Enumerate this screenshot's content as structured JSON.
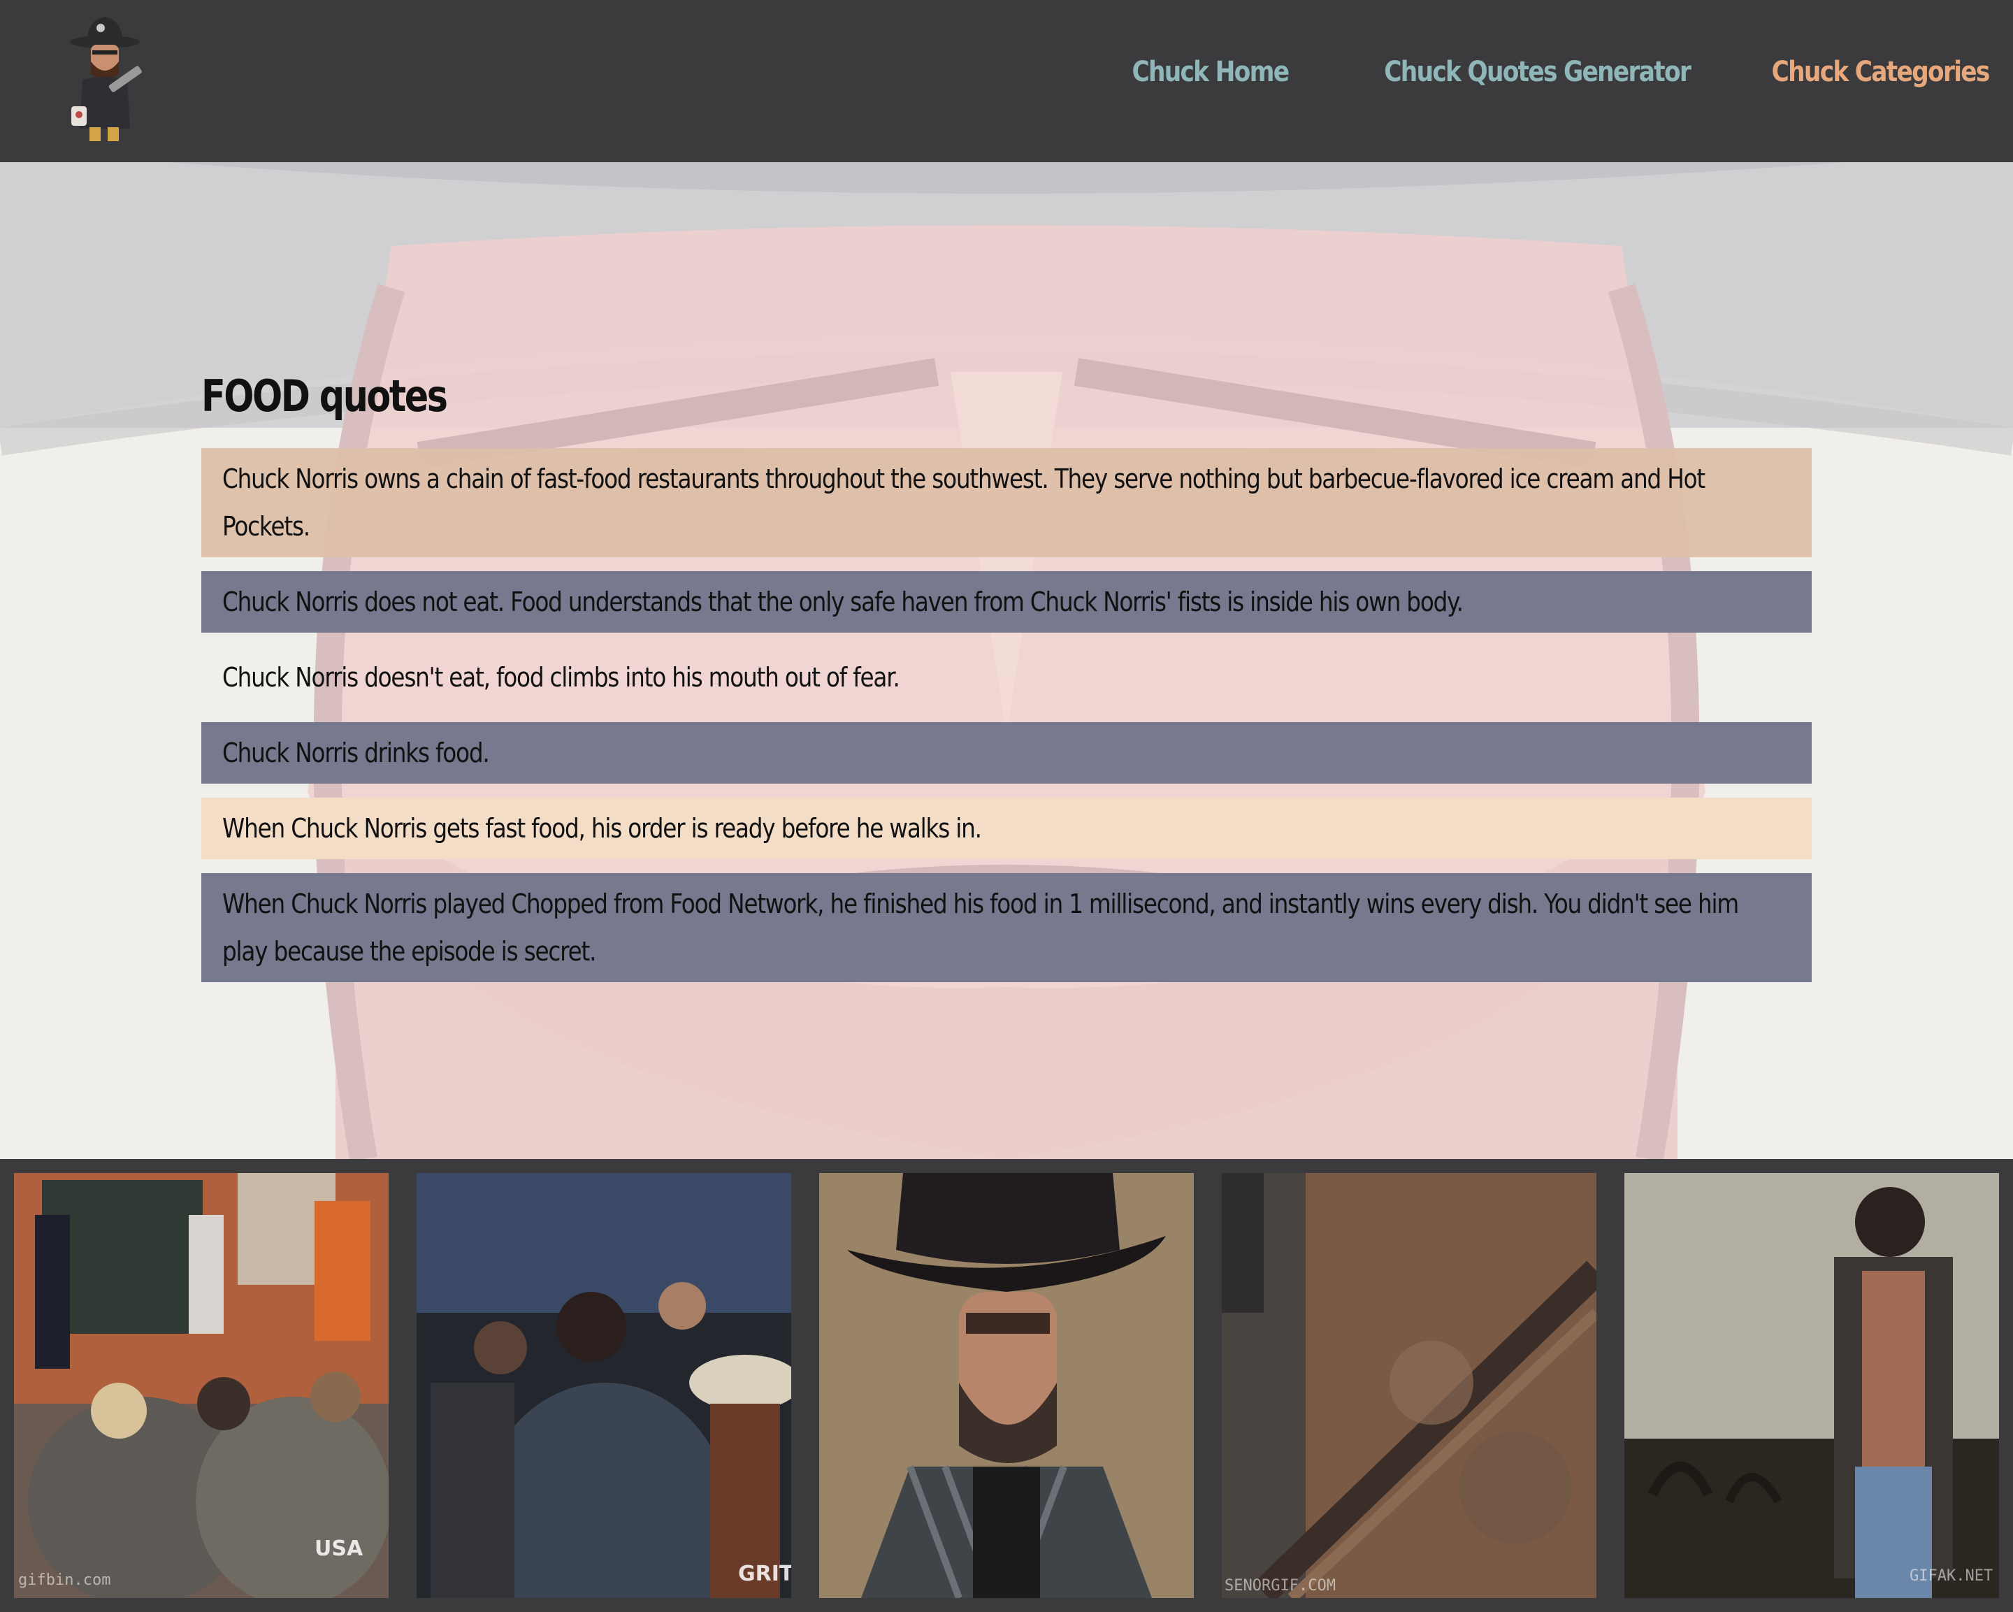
{
  "nav": {
    "items": [
      {
        "label": "Chuck Home"
      },
      {
        "label": "Chuck Quotes Generator"
      },
      {
        "label": "Chuck Categories"
      }
    ]
  },
  "category": {
    "title": "FOOD quotes",
    "quotes": [
      "Chuck Norris owns a chain of fast-food restaurants throughout the southwest. They serve nothing but barbecue-flavored ice cream and Hot Pockets.",
      "Chuck Norris does not eat. Food understands that the only safe haven from Chuck Norris' fists is inside his own body.",
      "Chuck Norris doesn't eat, food climbs into his mouth out of fear.",
      "Chuck Norris drinks food.",
      "When Chuck Norris gets fast food, his order is ready before he walks in.",
      "When Chuck Norris played Chopped from Food Network, he finished his food in 1 millisecond, and instantly wins every dish. You didn't see him play because the episode is secret."
    ]
  },
  "gallery": {
    "items": [
      {
        "watermark": "gifbin.com",
        "tag": "USA"
      },
      {
        "watermark": "",
        "tag": "GRIT"
      },
      {
        "watermark": "",
        "tag": ""
      },
      {
        "watermark": "SENORGIF.COM",
        "tag": ""
      },
      {
        "watermark": "GIFAK.NET",
        "tag": ""
      }
    ]
  },
  "colors": {
    "header_bg": "#3b3a3c",
    "nav_link": "#8fb7b9",
    "nav_active": "#e6a87c",
    "quote_tan": "#ddbfa9",
    "quote_slate": "#77798e",
    "quote_peach": "#f3ddc6"
  }
}
